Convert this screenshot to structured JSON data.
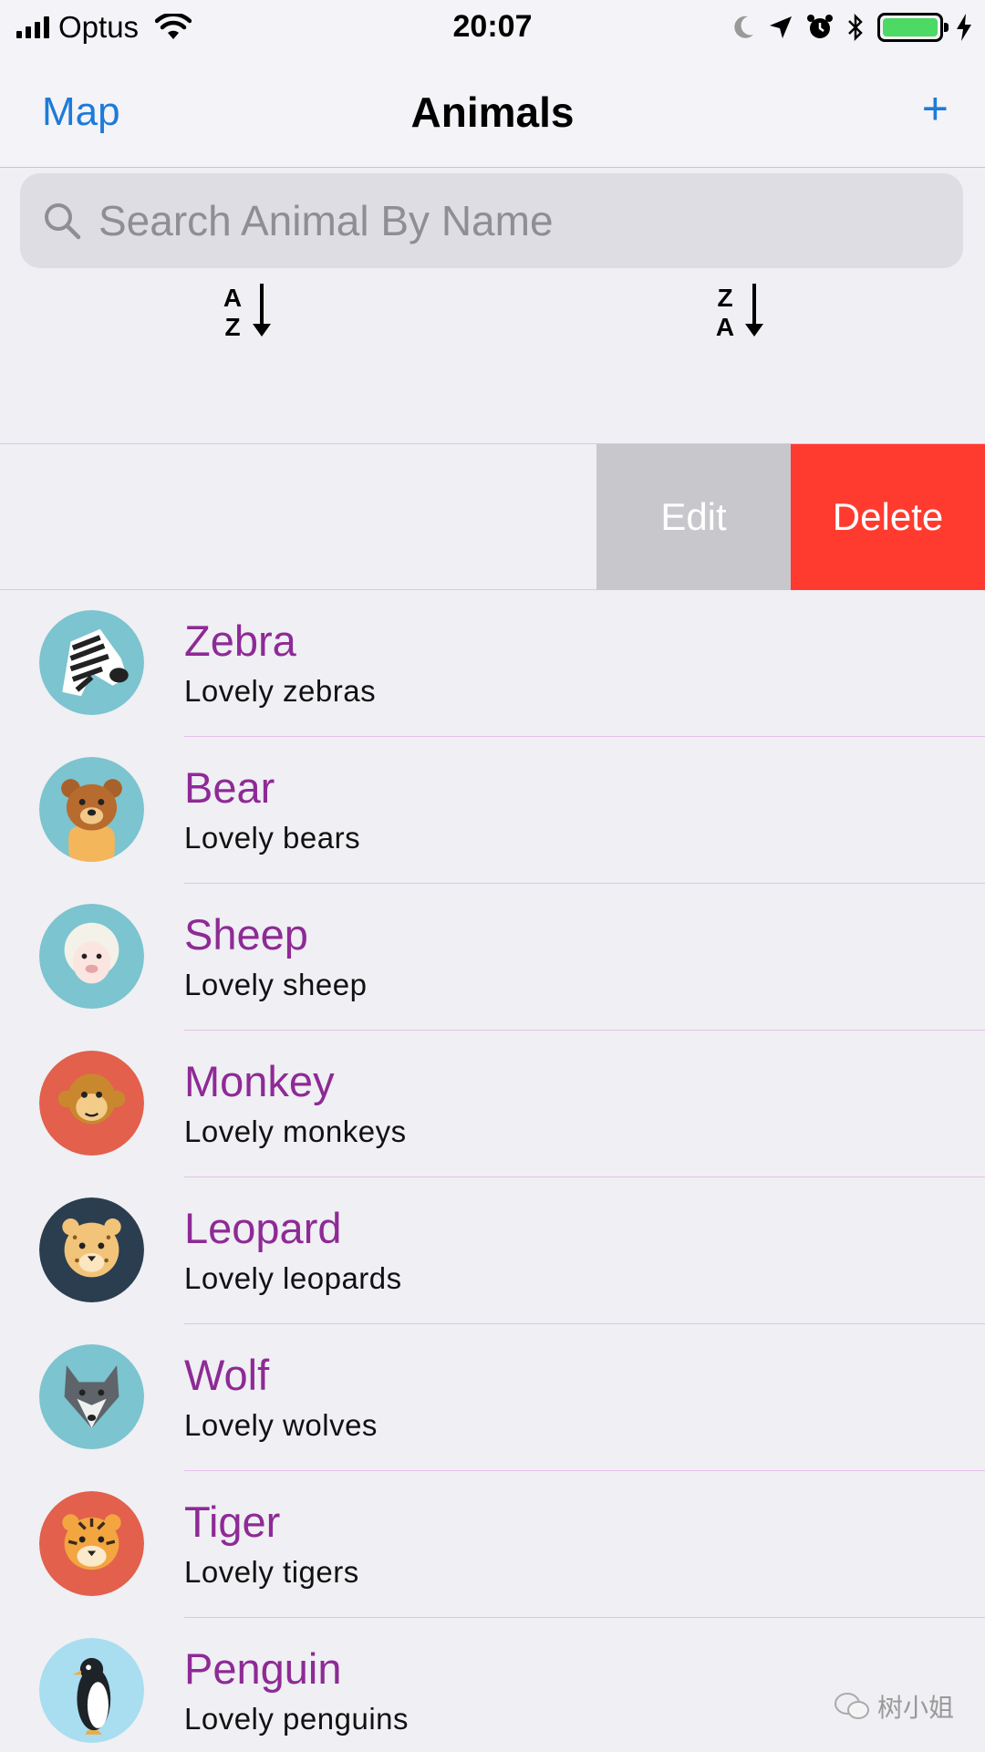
{
  "status_bar": {
    "carrier": "Optus",
    "time": "20:07",
    "icons": [
      "signal-icon",
      "wifi-icon",
      "moon-icon",
      "location-arrow-icon",
      "alarm-icon",
      "bluetooth-icon",
      "battery-icon",
      "charging-bolt-icon"
    ],
    "battery_color": "#4cd964"
  },
  "nav": {
    "left_label": "Map",
    "title": "Animals",
    "right_label": "+",
    "accent_color": "#1d7bd8"
  },
  "search": {
    "placeholder": "Search Animal By Name",
    "value": ""
  },
  "sort": {
    "az_top": "A",
    "az_bottom": "Z",
    "za_top": "Z",
    "za_bottom": "A"
  },
  "swipe_actions": {
    "edit_label": "Edit",
    "delete_label": "Delete",
    "delete_color": "#ff3b30",
    "edit_color": "#c8c7cc"
  },
  "animals": [
    {
      "name": "Zebra",
      "desc": "Lovely zebras",
      "icon": "zebra-icon"
    },
    {
      "name": "Bear",
      "desc": "Lovely bears",
      "icon": "bear-icon"
    },
    {
      "name": "Sheep",
      "desc": "Lovely sheep",
      "icon": "sheep-icon"
    },
    {
      "name": "Monkey",
      "desc": "Lovely monkeys",
      "icon": "monkey-icon"
    },
    {
      "name": "Leopard",
      "desc": "Lovely leopards",
      "icon": "leopard-icon"
    },
    {
      "name": "Wolf",
      "desc": "Lovely wolves",
      "icon": "wolf-icon"
    },
    {
      "name": "Tiger",
      "desc": "Lovely tigers",
      "icon": "tiger-icon"
    },
    {
      "name": "Penguin",
      "desc": "Lovely penguins",
      "icon": "penguin-icon"
    }
  ],
  "name_color": "#8e2a95",
  "watermark": "树小姐"
}
